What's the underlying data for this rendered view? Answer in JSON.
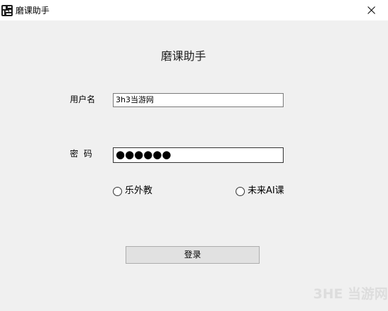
{
  "window": {
    "title": "磨课助手",
    "icon": "app-logo-icon",
    "close_icon": "close-icon"
  },
  "form": {
    "heading": "磨课助手",
    "username_label": "用户名",
    "username_value": "3h3当游网",
    "password_label": "密  码",
    "password_value": "●●●●●●",
    "options": [
      {
        "label": "乐外教",
        "selected": false
      },
      {
        "label": "未来AI课",
        "selected": false
      }
    ],
    "login_button": "登录"
  },
  "watermark": {
    "text": "3HE 当游网"
  }
}
